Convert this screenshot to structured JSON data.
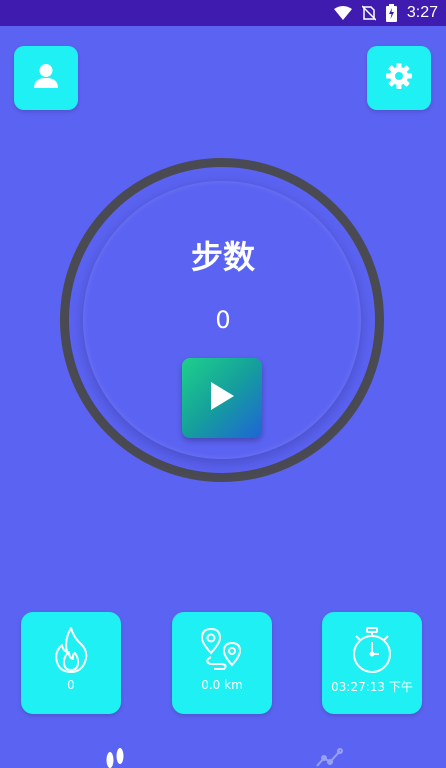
{
  "status_bar": {
    "time": "3:27",
    "icons": [
      "wifi-icon",
      "no-sim-icon",
      "battery-charging-icon"
    ]
  },
  "header": {
    "profile_icon": "person-icon",
    "settings_icon": "gear-icon"
  },
  "dial": {
    "title": "步数",
    "count": "0",
    "play_icon": "play-icon"
  },
  "stats": {
    "calories": {
      "icon": "flame-icon",
      "value": "0"
    },
    "distance": {
      "icon": "route-pin-icon",
      "value": "0.0 km"
    },
    "time": {
      "icon": "stopwatch-icon",
      "value": "03:27:13 下午"
    }
  },
  "bottom_nav": {
    "items": [
      {
        "icon": "footprints-icon",
        "active": true
      },
      {
        "icon": "chart-icon",
        "active": false
      }
    ]
  },
  "colors": {
    "background": "#5b63f2",
    "status_bar": "#3f1bb0",
    "accent_cyan": "#1ff0f3",
    "ring": "#4a4a52",
    "white": "#ffffff"
  }
}
